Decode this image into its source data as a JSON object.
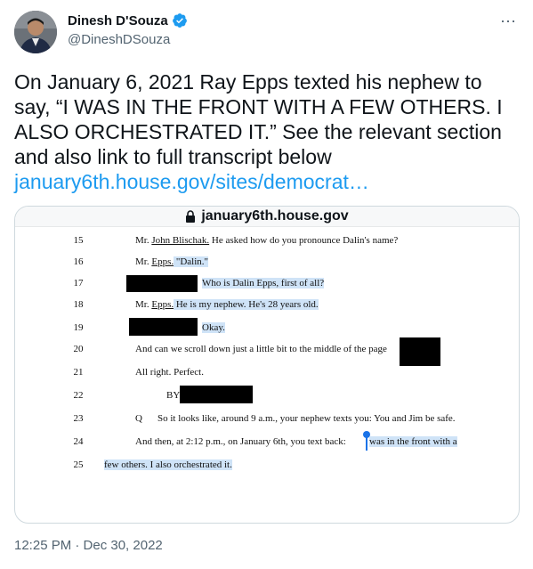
{
  "author": {
    "name": "Dinesh D'Souza",
    "handle": "@DineshDSouza"
  },
  "more_icon": "⋯",
  "tweet": {
    "text": "On January 6, 2021 Ray Epps texted his nephew to say, “I WAS IN THE FRONT WITH A FEW OTHERS. I ALSO ORCHESTRATED IT.” See the relevant section and also link to full transcript below",
    "link": "january6th.house.gov/sites/democrat…"
  },
  "card": {
    "url": "january6th.house.gov",
    "lines": [
      {
        "num": "15",
        "a": "Mr. ",
        "b": "John Blischak.",
        "c": "  He asked how do you pronounce Dalin's name?"
      },
      {
        "num": "16",
        "a": "Mr. ",
        "b": "Epps.",
        "c": "  \"Dalin.\""
      },
      {
        "num": "17",
        "c": "Who is Dalin Epps, first of all?"
      },
      {
        "num": "18",
        "a": "Mr. ",
        "b": "Epps.",
        "c": "  He is my nephew.   He's 28 years old."
      },
      {
        "num": "19",
        "c": "Okay."
      },
      {
        "num": "20",
        "c": "And can we scroll down just a little bit to the middle of the page"
      },
      {
        "num": "21",
        "c": "All right.   Perfect."
      },
      {
        "num": "22",
        "c": "BY"
      },
      {
        "num": "23",
        "q": "Q",
        "c": "So it looks like, around 9 a.m., your nephew texts you:   You and Jim be safe."
      },
      {
        "num": "24",
        "c": "And then, at 2:12 p.m., on January 6th, you text back:",
        "hl": "was in the front with a"
      },
      {
        "num": "25",
        "hl": "few others.   I also orchestrated it."
      }
    ]
  },
  "timestamp": "12:25 PM · Dec 30, 2022",
  "colors": {
    "link": "#1d9bf0",
    "verified": "#1d9bf0",
    "highlight": "#cfe3f7"
  }
}
